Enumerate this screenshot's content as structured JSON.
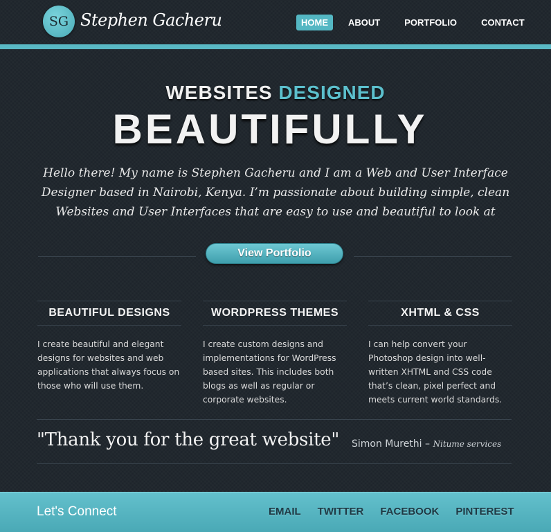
{
  "brand": {
    "initials": "SG",
    "name": "Stephen Gacheru"
  },
  "nav": {
    "items": [
      {
        "label": "HOME",
        "active": true
      },
      {
        "label": "ABOUT",
        "active": false
      },
      {
        "label": "PORTFOLIO",
        "active": false
      },
      {
        "label": "CONTACT",
        "active": false
      }
    ]
  },
  "hero": {
    "subtitle_plain": "WEBSITES ",
    "subtitle_accent": "DESIGNED",
    "title": "BEAUTIFULLY",
    "intro": "Hello there! My name is Stephen Gacheru and I am a Web and User Interface Designer based in Nairobi, Kenya. I’m passionate about building simple, clean Websites and User Interfaces that are easy to use and beautiful to look at",
    "cta_label": "View Portfolio"
  },
  "features": [
    {
      "title": "BEAUTIFUL DESIGNS",
      "body": "I create beautiful and elegant designs for websites and web applications that always focus on those who will use them."
    },
    {
      "title": "WORDPRESS THEMES",
      "body": "I create custom designs and implementations for WordPress based sites. This includes both blogs as well as regular or corporate websites."
    },
    {
      "title": "XHTML & CSS",
      "body": "I can help convert your Photoshop design into well-written XHTML and CSS code that’s clean, pixel perfect and meets current world standards."
    }
  ],
  "testimonial": {
    "quote": "\"Thank you for the great website\"",
    "author": "Simon Murethi",
    "separator": " – ",
    "company": "Nitume services"
  },
  "footer": {
    "title": "Let's Connect",
    "links": [
      "EMAIL",
      "TWITTER",
      "FACEBOOK",
      "PINTEREST"
    ]
  },
  "colors": {
    "background": "#1f262d",
    "accent": "#59b8c4",
    "footer_link": "#1e3944"
  }
}
